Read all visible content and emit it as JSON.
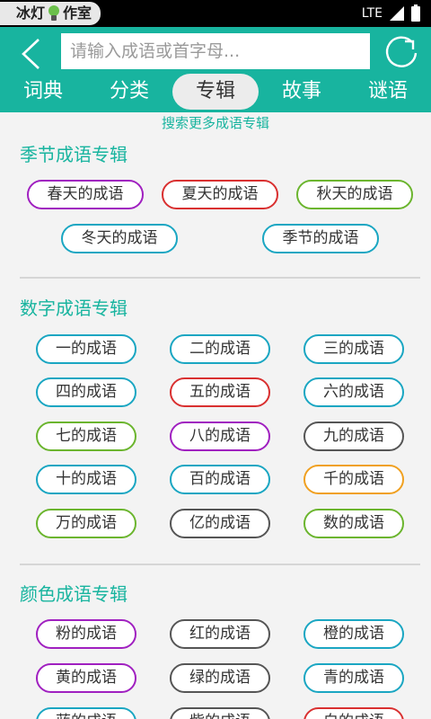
{
  "status_bar": {
    "logo_text_1": "冰灯",
    "logo_text_2": "作室",
    "network": "LTE"
  },
  "header": {
    "search_placeholder": "请输入成语或首字母...",
    "tabs": [
      {
        "label": "词典"
      },
      {
        "label": "分类"
      },
      {
        "label": "专辑"
      },
      {
        "label": "故事"
      },
      {
        "label": "谜语"
      }
    ],
    "active_tab": "专辑"
  },
  "search_more": "搜索更多成语专辑",
  "colors": {
    "accent": "#18b49f",
    "purple": "#a020c0",
    "red": "#d93030",
    "green": "#6bb52e",
    "teal": "#1aa6c2",
    "gray": "#555555",
    "orange": "#f0a020"
  },
  "sections": [
    {
      "title": "季节成语专辑",
      "items": [
        {
          "label": "春天的成语",
          "color": "#a020c0"
        },
        {
          "label": "夏天的成语",
          "color": "#d93030"
        },
        {
          "label": "秋天的成语",
          "color": "#6bb52e"
        },
        {
          "label": "冬天的成语",
          "color": "#1aa6c2"
        },
        {
          "label": "季节的成语",
          "color": "#1aa6c2"
        }
      ]
    },
    {
      "title": "数字成语专辑",
      "items": [
        {
          "label": "一的成语",
          "color": "#1aa6c2"
        },
        {
          "label": "二的成语",
          "color": "#1aa6c2"
        },
        {
          "label": "三的成语",
          "color": "#1aa6c2"
        },
        {
          "label": "四的成语",
          "color": "#1aa6c2"
        },
        {
          "label": "五的成语",
          "color": "#d93030"
        },
        {
          "label": "六的成语",
          "color": "#1aa6c2"
        },
        {
          "label": "七的成语",
          "color": "#6bb52e"
        },
        {
          "label": "八的成语",
          "color": "#a020c0"
        },
        {
          "label": "九的成语",
          "color": "#555555"
        },
        {
          "label": "十的成语",
          "color": "#1aa6c2"
        },
        {
          "label": "百的成语",
          "color": "#1aa6c2"
        },
        {
          "label": "千的成语",
          "color": "#f0a020"
        },
        {
          "label": "万的成语",
          "color": "#6bb52e"
        },
        {
          "label": "亿的成语",
          "color": "#555555"
        },
        {
          "label": "数的成语",
          "color": "#6bb52e"
        }
      ]
    },
    {
      "title": "颜色成语专辑",
      "items": [
        {
          "label": "粉的成语",
          "color": "#a020c0"
        },
        {
          "label": "红的成语",
          "color": "#555555"
        },
        {
          "label": "橙的成语",
          "color": "#1aa6c2"
        },
        {
          "label": "黄的成语",
          "color": "#a020c0"
        },
        {
          "label": "绿的成语",
          "color": "#555555"
        },
        {
          "label": "青的成语",
          "color": "#1aa6c2"
        },
        {
          "label": "蓝的成语",
          "color": "#1aa6c2"
        },
        {
          "label": "紫的成语",
          "color": "#555555"
        },
        {
          "label": "白的成语",
          "color": "#d93030"
        }
      ]
    }
  ]
}
